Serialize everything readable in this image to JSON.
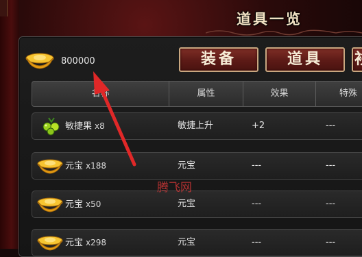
{
  "window": {
    "title": "道具一览"
  },
  "currency": {
    "amount": "800000",
    "icon": "gold-ingot-icon"
  },
  "tabs": [
    {
      "label": "装备"
    },
    {
      "label": "道具"
    },
    {
      "label": "衫"
    }
  ],
  "table": {
    "headers": [
      "名称",
      "属性",
      "效果",
      "特殊"
    ],
    "rows": [
      {
        "icon": "fruit-icon",
        "name": "敏捷果",
        "qty": "x8",
        "attr": "敏捷上升",
        "effect": "+2",
        "special": "---"
      },
      {
        "icon": "gold-ingot-icon",
        "name": "元宝",
        "qty": "x188",
        "attr": "元宝",
        "effect": "---",
        "special": "---"
      },
      {
        "icon": "gold-ingot-icon",
        "name": "元宝",
        "qty": "x50",
        "attr": "元宝",
        "effect": "---",
        "special": "---"
      },
      {
        "icon": "gold-ingot-icon",
        "name": "元宝",
        "qty": "x298",
        "attr": "元宝",
        "effect": "---",
        "special": "---"
      }
    ]
  },
  "watermark": "腾飞网",
  "colors": {
    "tab_bg": "#5c1a16",
    "tab_border": "#c9a780",
    "arrow": "#e02828",
    "gold": "#f2b01e"
  }
}
